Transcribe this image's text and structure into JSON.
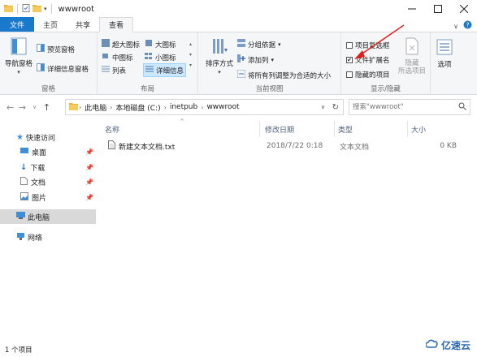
{
  "window": {
    "title": "wwwroot",
    "controls": [
      "minimize",
      "maximize",
      "close"
    ]
  },
  "tabs": [
    {
      "label": "文件"
    },
    {
      "label": "主页"
    },
    {
      "label": "共享"
    },
    {
      "label": "查看"
    }
  ],
  "ribbon": {
    "pane_group": {
      "label": "窗格",
      "nav_pane": "导航窗格",
      "preview_pane": "预览窗格",
      "details_pane": "详细信息窗格"
    },
    "layout_group": {
      "label": "布局",
      "items": [
        "超大图标",
        "大图标",
        "中图标",
        "小图标",
        "列表",
        "详细信息"
      ],
      "selected": "详细信息"
    },
    "current_view_group": {
      "label": "当前视图",
      "sort_by": "排序方式",
      "group_by": "分组依据",
      "add_column": "添加列",
      "fit_columns": "将所有列调整为合适的大小"
    },
    "show_hide_group": {
      "label": "显示/隐藏",
      "item_checkboxes": {
        "label": "项目复选框",
        "checked": false
      },
      "file_extensions": {
        "label": "文件扩展名",
        "checked": true
      },
      "hidden_items": {
        "label": "隐藏的项目",
        "checked": false
      },
      "hide_selected_line1": "隐藏",
      "hide_selected_line2": "所选项目"
    },
    "options": "选项"
  },
  "address": {
    "crumbs": [
      "此电脑",
      "本地磁盘 (C:)",
      "inetpub",
      "wwwroot"
    ]
  },
  "search": {
    "placeholder": "搜索\"wwwroot\""
  },
  "nav": {
    "quick_access": "快速访问",
    "quick_items": [
      "桌面",
      "下载",
      "文档",
      "图片"
    ],
    "this_pc": "此电脑",
    "network": "网络"
  },
  "columns": [
    "名称",
    "修改日期",
    "类型",
    "大小"
  ],
  "files": [
    {
      "name": "新建文本文档.txt",
      "modified": "2018/7/22 0:18",
      "type": "文本文档",
      "size": "0 KB"
    }
  ],
  "status": {
    "count": "1 个项目"
  },
  "watermark": "亿速云",
  "colors": {
    "file_tab": "#1979ca",
    "selection": "#cce8ff",
    "arrow": "#e02020"
  }
}
